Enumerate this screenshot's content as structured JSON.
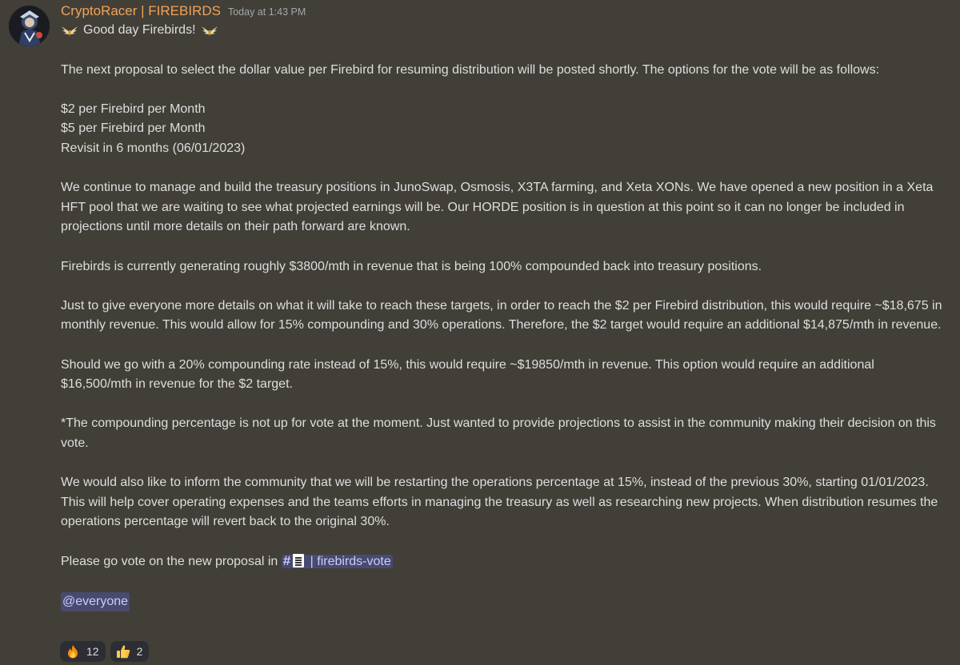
{
  "message": {
    "username": "CryptoRacer | FIREBIRDS",
    "timestamp": "Today at 1:43 PM",
    "greeting": "Good day Firebirds!",
    "paragraphs": {
      "intro": "The next proposal to select the dollar value per Firebird for resuming distribution will be posted shortly. The options for the vote will be as follows:",
      "option_1": "$2 per Firebird per Month",
      "option_2": "$5 per Firebird per Month",
      "option_3": "Revisit in 6 months (06/01/2023)",
      "treasury": "We continue to manage and build the treasury positions in JunoSwap, Osmosis, X3TA farming, and Xeta XONs. We have opened a new position in a Xeta HFT pool that we are waiting to see what projected earnings will be. Our HORDE position is in question at this point so it can no longer be included in projections until more details on their path forward are known.",
      "revenue": "Firebirds is currently generating roughly $3800/mth in revenue that is being 100% compounded back into treasury positions.",
      "targets": "Just to give everyone more details on what it will take to reach these targets, in order to reach the $2 per Firebird distribution, this would require ~$18,675 in monthly revenue. This would allow for 15% compounding and 30% operations. Therefore, the $2 target would require an additional $14,875/mth in revenue.",
      "compounding": "Should we go with a 20% compounding rate instead of 15%, this would require ~$19850/mth in revenue. This option would require an additional $16,500/mth in revenue for the $2 target.",
      "note": "*The compounding percentage is not up for vote at the moment. Just wanted to provide projections to assist in the community making their decision on this vote.",
      "operations": "We would also like to inform the community that we will be restarting the operations percentage at 15%, instead of the previous 30%, starting 01/01/2023. This will help cover operating expenses and the teams efforts in managing the treasury as well as researching new projects. When distribution resumes the operations percentage will revert back to the original 30%.",
      "vote_prefix": "Please go vote on the new proposal in "
    },
    "channel_mention": {
      "hash": "#",
      "name": " | firebirds-vote"
    },
    "everyone_mention": "@everyone"
  },
  "reactions": [
    {
      "emoji": "fire-emoji",
      "count": "12"
    },
    {
      "emoji": "thumbs-up-emoji",
      "count": "2"
    }
  ],
  "colors": {
    "background": "#423f38",
    "username": "#f0a35a",
    "timestamp": "#a3a6aa",
    "text": "#dddedf",
    "mention_bg": "rgba(88,101,242,0.30)",
    "mention_text": "#c9cdfb",
    "reaction_bg": "#2d2e33"
  }
}
